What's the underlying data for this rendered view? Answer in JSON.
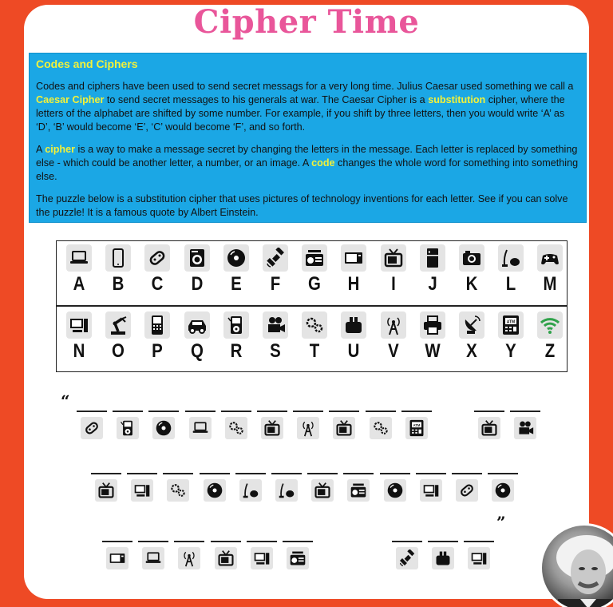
{
  "title": "Cipher Time",
  "info": {
    "heading": "Codes and Ciphers",
    "p1_a": "Codes and ciphers have been used to send secret messags for a very long time. Julius Caesar used something we call a ",
    "p1_hl1": "Caesar Cipher",
    "p1_b": " to send secret messages to his generals at war. The Caesar Cipher is a ",
    "p1_hl2": "substitution",
    "p1_c": " cipher, where the letters of the alphabet are shifted by some number. For example, if you shift by three letters, then you would write ‘A’ as ‘D’, ‘B’ would become ‘E’, ‘C’ would become ‘F’, and so forth.",
    "p2_a": "A ",
    "p2_hl1": "cipher",
    "p2_b": " is a way to make a message secret by changing the letters in the message. Each letter is replaced by something else - which could be another letter, a number, or an image. A ",
    "p2_hl2": "code",
    "p2_c": " changes the whole word for something into something else.",
    "p3": "The puzzle below is a substitution cipher that uses pictures of technology inventions for each letter. See if you can solve the puzzle! It is a famous quote by Albert Einstein."
  },
  "key": [
    {
      "letter": "A",
      "icon": "laptop-icon"
    },
    {
      "letter": "B",
      "icon": "smartphone-icon"
    },
    {
      "letter": "C",
      "icon": "game-controller-icon"
    },
    {
      "letter": "D",
      "icon": "washing-machine-icon"
    },
    {
      "letter": "E",
      "icon": "disc-icon"
    },
    {
      "letter": "F",
      "icon": "satellite-icon"
    },
    {
      "letter": "G",
      "icon": "radio-icon"
    },
    {
      "letter": "H",
      "icon": "microwave-icon"
    },
    {
      "letter": "I",
      "icon": "television-icon"
    },
    {
      "letter": "J",
      "icon": "refrigerator-icon"
    },
    {
      "letter": "K",
      "icon": "camera-icon"
    },
    {
      "letter": "L",
      "icon": "vacuum-cleaner-icon"
    },
    {
      "letter": "M",
      "icon": "gamepad-icon"
    },
    {
      "letter": "N",
      "icon": "desktop-computer-icon"
    },
    {
      "letter": "O",
      "icon": "robot-arm-icon"
    },
    {
      "letter": "P",
      "icon": "cell-phone-icon"
    },
    {
      "letter": "Q",
      "icon": "car-icon"
    },
    {
      "letter": "R",
      "icon": "mp3-player-icon"
    },
    {
      "letter": "S",
      "icon": "movie-projector-icon"
    },
    {
      "letter": "T",
      "icon": "gears-icon"
    },
    {
      "letter": "U",
      "icon": "toaster-icon"
    },
    {
      "letter": "V",
      "icon": "radio-tower-icon"
    },
    {
      "letter": "W",
      "icon": "printer-icon"
    },
    {
      "letter": "X",
      "icon": "satellite-dish-icon"
    },
    {
      "letter": "Y",
      "icon": "atm-icon"
    },
    {
      "letter": "Z",
      "icon": "wifi-icon"
    }
  ],
  "puzzle": {
    "open_quote": "“",
    "close_quote": "”",
    "lines": [
      [
        [
          "C",
          "R",
          "E",
          "A",
          "T",
          "I",
          "V",
          "I",
          "T",
          "Y"
        ],
        [
          "I",
          "S"
        ]
      ],
      [
        [
          "I",
          "N",
          "T",
          "E",
          "L",
          "L",
          "I",
          "G",
          "E",
          "N",
          "C",
          "E"
        ]
      ],
      [
        [
          "H",
          "A",
          "V",
          "I",
          "N",
          "G"
        ],
        [
          "F",
          "U",
          "N"
        ]
      ]
    ]
  }
}
